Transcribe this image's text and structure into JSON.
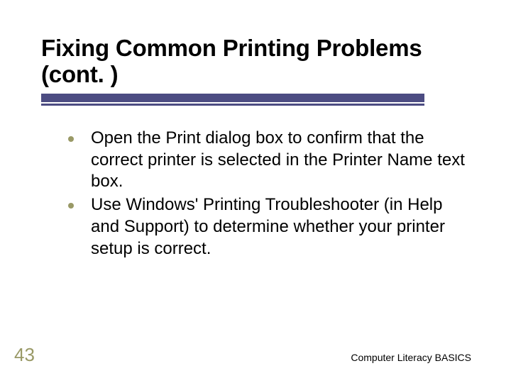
{
  "title": "Fixing Common Printing Problems (cont. )",
  "bullets": [
    "Open the Print dialog box to confirm that the correct printer is selected in the Printer Name text box.",
    "Use Windows' Printing Troubleshooter (in Help and Support) to determine whether your printer setup is correct."
  ],
  "slide_number": "43",
  "footer": "Computer Literacy BASICS",
  "colors": {
    "accent_bar": "#4c4c82",
    "bullet": "#999966",
    "slide_number": "#999966"
  }
}
